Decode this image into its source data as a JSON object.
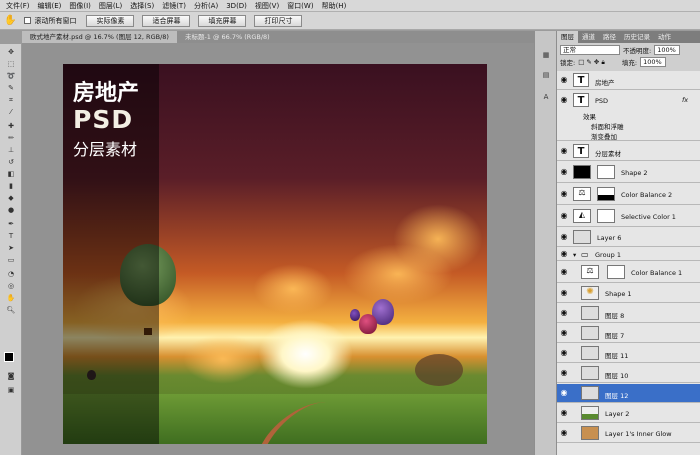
{
  "menubar": {
    "items": [
      "文件(F)",
      "编辑(E)",
      "图像(I)",
      "图层(L)",
      "选择(S)",
      "滤镜(T)",
      "分析(A)",
      "3D(D)",
      "视图(V)",
      "窗口(W)",
      "帮助(H)"
    ]
  },
  "options": {
    "scroll_all": "滚动所有窗口",
    "buttons": [
      "实际像素",
      "适合屏幕",
      "填充屏幕",
      "打印尺寸"
    ]
  },
  "doc_tabs": [
    {
      "label": "欧式地产素材.psd @ 16.7% (图层 12, RGB/8)"
    },
    {
      "label": "未标题-1 @ 66.7% (RGB/8)"
    }
  ],
  "artwork": {
    "line1": "房地产",
    "line2": "PSD",
    "line3": "分层素材"
  },
  "panel": {
    "tabs": [
      "图层",
      "通道",
      "路径",
      "历史记录",
      "动作"
    ],
    "blend_mode": "正常",
    "opacity_label": "不透明度:",
    "opacity_value": "100%",
    "lock_label": "锁定:",
    "fill_label": "填充:",
    "fill_value": "100%",
    "layers": [
      {
        "name": "房地产",
        "thumb": "T"
      },
      {
        "name": "PSD",
        "thumb": "T",
        "fx": "fx"
      },
      {
        "name": "效果"
      },
      {
        "name": "斜面和浮雕"
      },
      {
        "name": "渐变叠加"
      },
      {
        "name": "分层素材",
        "thumb": "T"
      },
      {
        "name": "Shape 2"
      },
      {
        "name": "Color Balance 2"
      },
      {
        "name": "Selective Color 1"
      },
      {
        "name": "Layer 6"
      },
      {
        "name": "Group 1"
      },
      {
        "name": "Color Balance 1"
      },
      {
        "name": "Shape 1"
      },
      {
        "name": "图层 8"
      },
      {
        "name": "图层 7"
      },
      {
        "name": "图层 11"
      },
      {
        "name": "图层 10"
      },
      {
        "name": "图层 12"
      },
      {
        "name": "Layer 2"
      },
      {
        "name": "Layer 1's Inner Glow"
      }
    ]
  }
}
